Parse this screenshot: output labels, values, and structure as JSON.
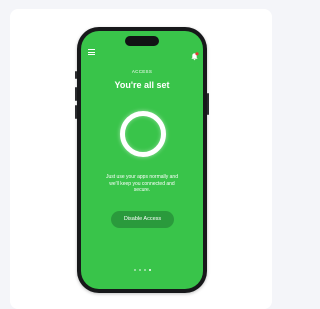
{
  "screen": {
    "eyebrow": "ACCESS",
    "title": "You're all set",
    "description": "Just use your apps normally and we'll keep you connected and secure.",
    "disable_button_label": "Disable Access"
  },
  "pagination": {
    "total": 4,
    "active_index": 3
  },
  "icons": {
    "menu": "hamburger-menu-icon",
    "notification": "bell-icon"
  },
  "colors": {
    "screen_background": "#39c44a",
    "button_background": "#2a9a3c",
    "notification_badge": "#e53935",
    "phone_frame": "#17181a"
  }
}
